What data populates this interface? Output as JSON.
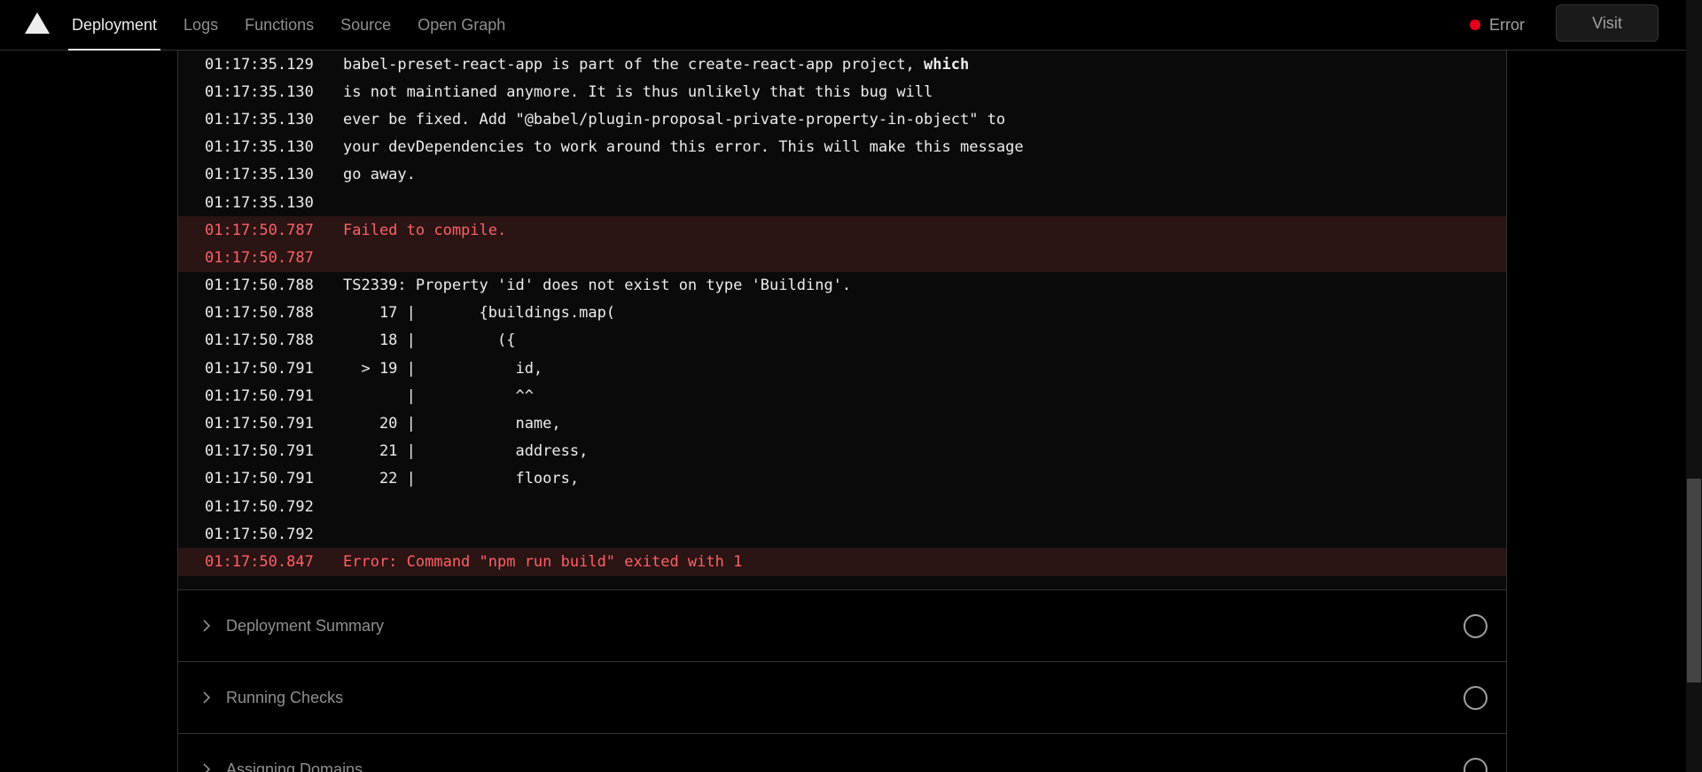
{
  "nav": {
    "tabs": [
      {
        "label": "Deployment",
        "active": true
      },
      {
        "label": "Logs"
      },
      {
        "label": "Functions"
      },
      {
        "label": "Source"
      },
      {
        "label": "Open Graph"
      }
    ],
    "status_label": "Error",
    "status_color": "#e5001c",
    "visit_label": "Visit"
  },
  "logs": {
    "lines": [
      {
        "ts": "01:17:35.129",
        "msg": "babel-preset-react-app is part of the create-react-app project, ",
        "bold": "which"
      },
      {
        "ts": "01:17:35.130",
        "msg": "is not maintianed anymore. It is thus unlikely that this bug will"
      },
      {
        "ts": "01:17:35.130",
        "msg": "ever be fixed. Add \"@babel/plugin-proposal-private-property-in-object\" to"
      },
      {
        "ts": "01:17:35.130",
        "msg": "your devDependencies to work around this error. This will make this message"
      },
      {
        "ts": "01:17:35.130",
        "msg": "go away."
      },
      {
        "ts": "01:17:35.130",
        "msg": ""
      },
      {
        "ts": "01:17:50.787",
        "msg": "Failed to compile.",
        "error": true
      },
      {
        "ts": "01:17:50.787",
        "msg": "",
        "error": true
      },
      {
        "ts": "01:17:50.788",
        "msg": "TS2339: Property 'id' does not exist on type 'Building'."
      },
      {
        "ts": "01:17:50.788",
        "msg": "    17 |       {buildings.map("
      },
      {
        "ts": "01:17:50.788",
        "msg": "    18 |         ({"
      },
      {
        "ts": "01:17:50.791",
        "msg": "  > 19 |           id,"
      },
      {
        "ts": "01:17:50.791",
        "msg": "       |           ^^"
      },
      {
        "ts": "01:17:50.791",
        "msg": "    20 |           name,"
      },
      {
        "ts": "01:17:50.791",
        "msg": "    21 |           address,"
      },
      {
        "ts": "01:17:50.791",
        "msg": "    22 |           floors,"
      },
      {
        "ts": "01:17:50.792",
        "msg": ""
      },
      {
        "ts": "01:17:50.792",
        "msg": ""
      },
      {
        "ts": "01:17:50.847",
        "msg": "Error: Command \"npm run build\" exited with 1",
        "error": true
      }
    ]
  },
  "sections": [
    {
      "title": "Deployment Summary"
    },
    {
      "title": "Running Checks"
    },
    {
      "title": "Assigning Domains"
    }
  ],
  "icons": {
    "logo": "vercel-triangle-icon",
    "section_chevron": "chevron-right-icon",
    "section_status": "pending-circle-icon"
  }
}
